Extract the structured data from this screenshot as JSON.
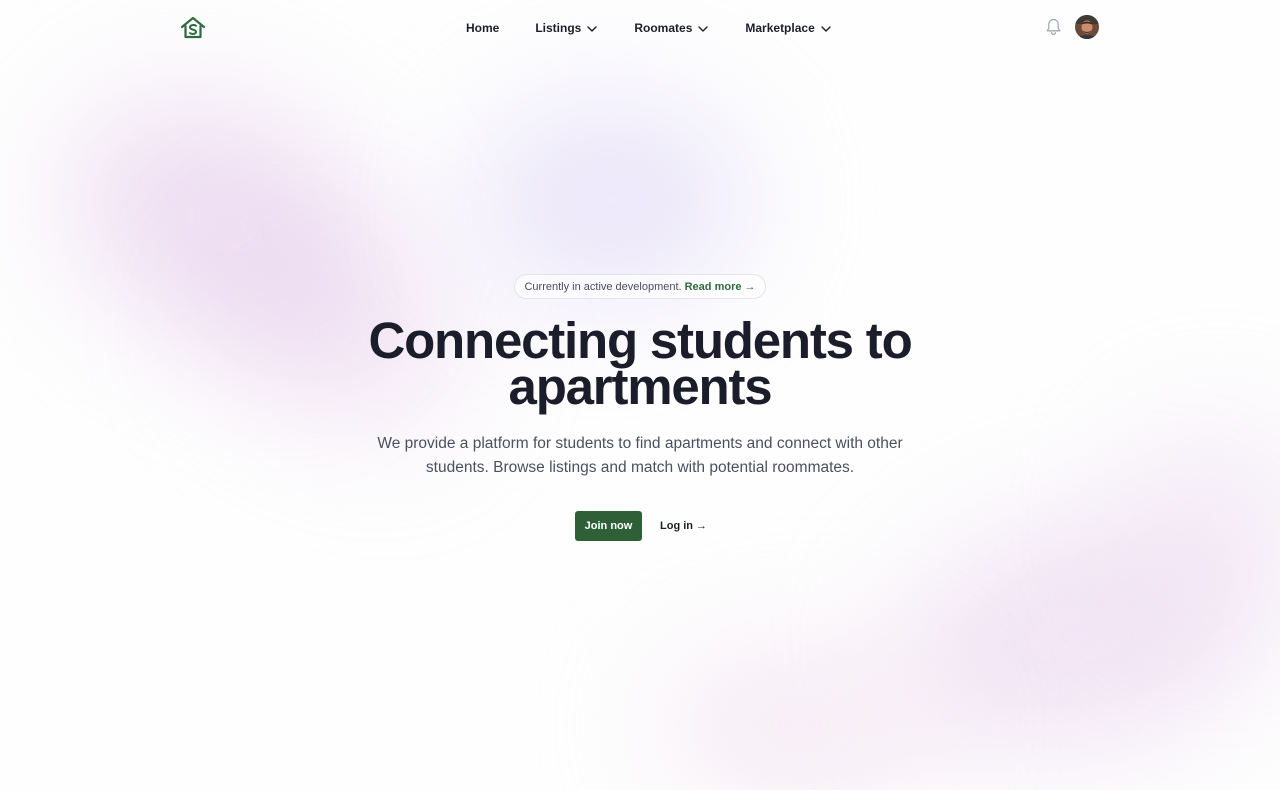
{
  "header": {
    "logo_icon": "house-s-logo-icon",
    "nav": {
      "home": "Home",
      "listings": "Listings",
      "roommates": "Roomates",
      "marketplace": "Marketplace"
    },
    "notifications_icon": "bell-icon",
    "avatar_icon": "user-avatar"
  },
  "hero": {
    "badge_text": "Currently in active development.",
    "badge_link": "Read more →",
    "title": "Connecting students to apartments",
    "subtitle": "We provide a platform for students to find apartments and connect with other students. Browse listings and match with potential roommates.",
    "join_button": "Join now",
    "login_link": "Log in →"
  },
  "colors": {
    "brand_green": "#2f5f37",
    "link_green": "#2f6b3e",
    "text_dark": "#1b1e2a",
    "text_muted": "#4b5060"
  }
}
